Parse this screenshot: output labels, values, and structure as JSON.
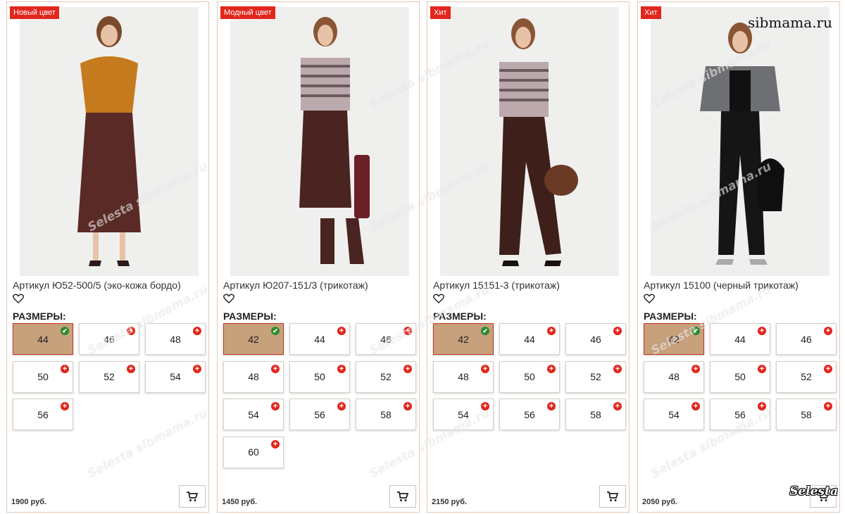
{
  "site_watermark": "sibmama.ru",
  "logo_watermark": "Selesta",
  "diagonal_watermark": "Selesta sibmama.ru",
  "sizes_heading": "РАЗМЕРЫ:",
  "colors": {
    "badge": "#e1261c",
    "selected_size": "#c7a07c",
    "available_check": "#2e8b2e",
    "add_plus": "#e1261c"
  },
  "products": [
    {
      "badge": "Новый цвет",
      "title": "Артикул Ю52-500/5 (эко-кожа бордо)",
      "price": "1900 руб.",
      "selected_size": "44",
      "sizes": [
        "44",
        "46",
        "48",
        "50",
        "52",
        "54",
        "56"
      ],
      "image_alt": "woman in mustard sweater and burgundy leather skirt"
    },
    {
      "badge": "Модный цвет",
      "title": "Артикул Ю207-151/3 (трикотаж)",
      "price": "1450 руб.",
      "selected_size": "42",
      "sizes": [
        "42",
        "44",
        "46",
        "48",
        "50",
        "52",
        "54",
        "56",
        "58",
        "60"
      ],
      "image_alt": "woman in striped top and brown knit skirt"
    },
    {
      "badge": "Хит",
      "title": "Артикул 15151-3 (трикотаж)",
      "price": "2150 руб.",
      "selected_size": "42",
      "sizes": [
        "42",
        "44",
        "46",
        "48",
        "50",
        "52",
        "54",
        "56",
        "58"
      ],
      "image_alt": "woman in striped top and brown flared trousers"
    },
    {
      "badge": "Хит",
      "title": "Артикул 15100 (черный трикотаж)",
      "price": "2050 руб.",
      "selected_size": "42",
      "sizes": [
        "42",
        "44",
        "46",
        "48",
        "50",
        "52",
        "54",
        "56",
        "58"
      ],
      "image_alt": "woman in grey blazer and black trousers"
    }
  ]
}
